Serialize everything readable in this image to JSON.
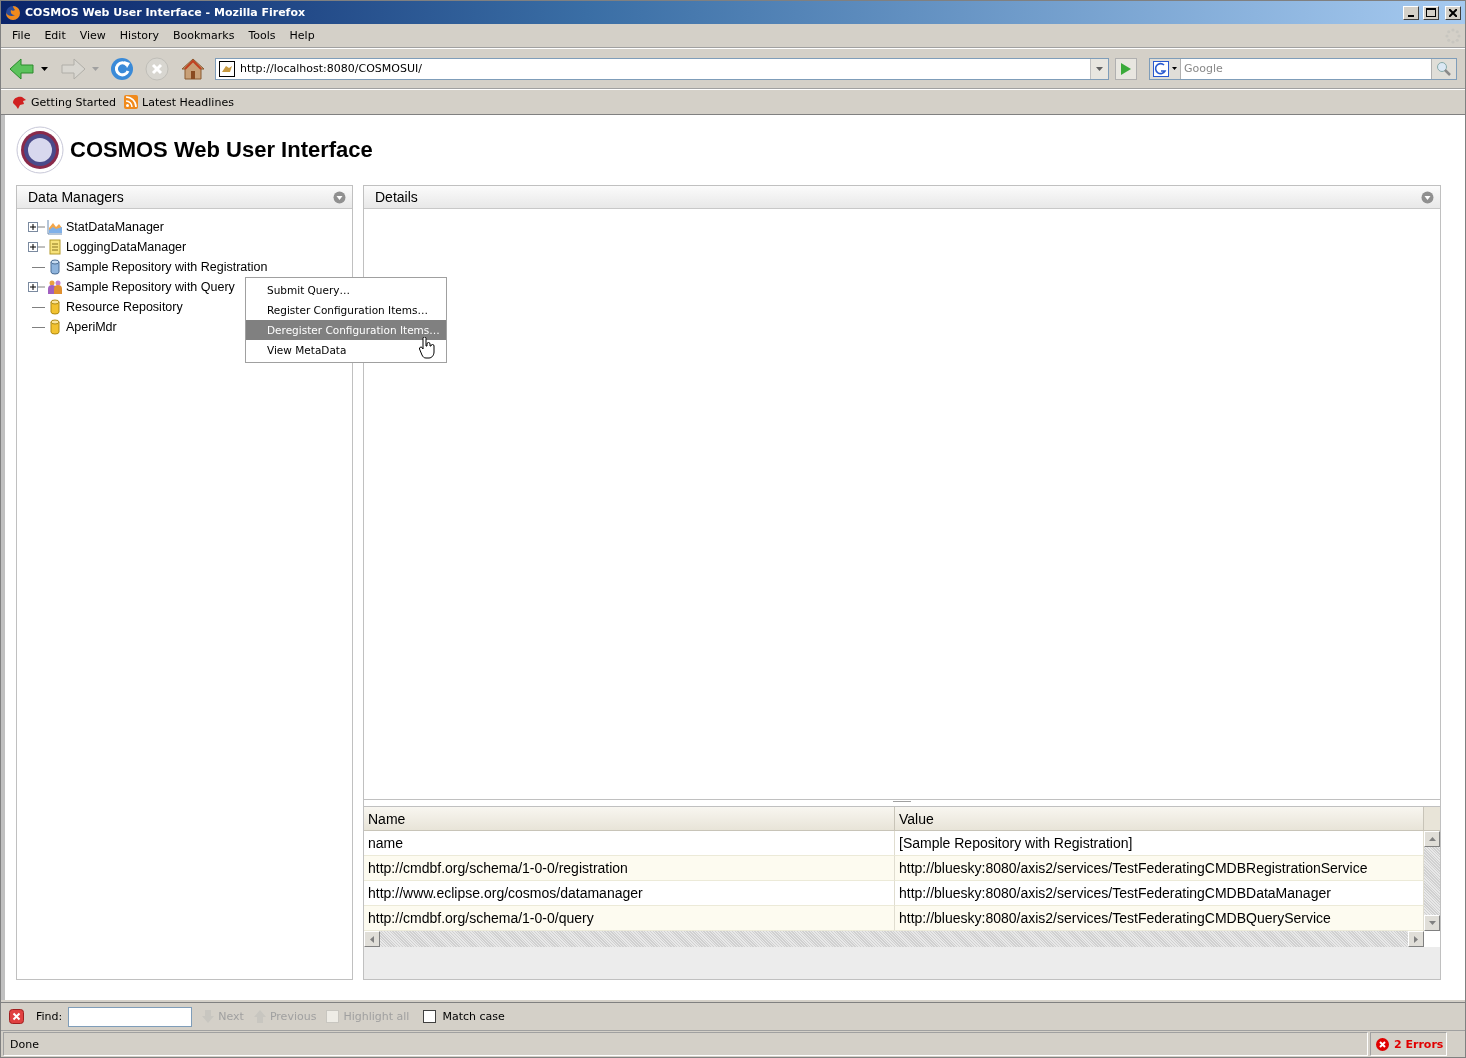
{
  "window": {
    "title": "COSMOS Web User Interface - Mozilla Firefox"
  },
  "menu": [
    "File",
    "Edit",
    "View",
    "History",
    "Bookmarks",
    "Tools",
    "Help"
  ],
  "toolbar": {
    "url": "http://localhost:8080/COSMOSUI/",
    "search_placeholder": "Google"
  },
  "bookmarks": [
    "Getting Started",
    "Latest Headlines"
  ],
  "page": {
    "title": "COSMOS Web User Interface",
    "data_managers": {
      "title": "Data Managers",
      "items": [
        {
          "label": "StatDataManager",
          "kind": "branch",
          "expanded": false
        },
        {
          "label": "LoggingDataManager",
          "kind": "branch",
          "expanded": false
        },
        {
          "label": "Sample Repository with Registration",
          "kind": "leaf"
        },
        {
          "label": "Sample Repository with Query",
          "kind": "branch",
          "expanded": false
        },
        {
          "label": "Resource Repository",
          "kind": "leaf"
        },
        {
          "label": "AperiMdr",
          "kind": "leaf"
        }
      ]
    },
    "context_menu": [
      {
        "label": "Submit Query…",
        "selected": false
      },
      {
        "label": "Register Configuration Items…",
        "selected": false
      },
      {
        "label": "Deregister Configuration Items…",
        "selected": true
      },
      {
        "label": "View MetaData",
        "selected": false
      }
    ],
    "details": {
      "title": "Details",
      "table": {
        "columns": [
          "Name",
          "Value"
        ],
        "rows": [
          [
            "name",
            "[Sample Repository with Registration]"
          ],
          [
            "http://cmdbf.org/schema/1-0-0/registration",
            "http://bluesky:8080/axis2/services/TestFederatingCMDBRegistrationService"
          ],
          [
            "http://www.eclipse.org/cosmos/datamanager",
            "http://bluesky:8080/axis2/services/TestFederatingCMDBDataManager"
          ],
          [
            "http://cmdbf.org/schema/1-0-0/query",
            "http://bluesky:8080/axis2/services/TestFederatingCMDBQueryService"
          ]
        ]
      }
    }
  },
  "find_bar": {
    "label": "Find:",
    "buttons": [
      {
        "label": "Next",
        "disabled": true
      },
      {
        "label": "Previous",
        "disabled": true
      },
      {
        "label": "Highlight all",
        "disabled": true
      }
    ],
    "match_case": {
      "label": "Match case",
      "checked": false
    }
  },
  "status_bar": {
    "text": "Done",
    "errors": "2 Errors"
  }
}
